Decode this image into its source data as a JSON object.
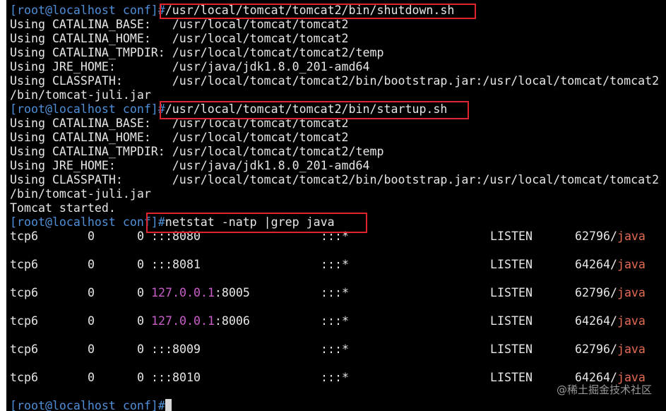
{
  "terminal": {
    "prompt": "[root@localhost conf]#",
    "blocks": [
      {
        "command": "/usr/local/tomcat/tomcat2/bin/shutdown.sh",
        "output": [
          "Using CATALINA_BASE:   /usr/local/tomcat/tomcat2",
          "Using CATALINA_HOME:   /usr/local/tomcat/tomcat2",
          "Using CATALINA_TMPDIR: /usr/local/tomcat/tomcat2/temp",
          "Using JRE_HOME:        /usr/java/jdk1.8.0_201-amd64",
          "Using CLASSPATH:       /usr/local/tomcat/tomcat2/bin/bootstrap.jar:/usr/local/tomcat/tomcat2",
          "/bin/tomcat-juli.jar"
        ]
      },
      {
        "command": "/usr/local/tomcat/tomcat2/bin/startup.sh",
        "output": [
          "Using CATALINA_BASE:   /usr/local/tomcat/tomcat2",
          "Using CATALINA_HOME:   /usr/local/tomcat/tomcat2",
          "Using CATALINA_TMPDIR: /usr/local/tomcat/tomcat2/temp",
          "Using JRE_HOME:        /usr/java/jdk1.8.0_201-amd64",
          "Using CLASSPATH:       /usr/local/tomcat/tomcat2/bin/bootstrap.jar:/usr/local/tomcat/tomcat2",
          "/bin/tomcat-juli.jar",
          "Tomcat started."
        ]
      },
      {
        "command": "netstat -natp |grep java"
      }
    ],
    "netstat_rows": [
      {
        "proto": "tcp6",
        "recv_q": "0",
        "send_q": "0",
        "local_ip": "",
        "local_port": ":::8080",
        "foreign": ":::*",
        "state": "LISTEN",
        "pid": "62796/",
        "program": "java"
      },
      {
        "proto": "tcp6",
        "recv_q": "0",
        "send_q": "0",
        "local_ip": "",
        "local_port": ":::8081",
        "foreign": ":::*",
        "state": "LISTEN",
        "pid": "64264/",
        "program": "java"
      },
      {
        "proto": "tcp6",
        "recv_q": "0",
        "send_q": "0",
        "local_ip": "127.0.0.1",
        "local_port": ":8005",
        "foreign": ":::*",
        "state": "LISTEN",
        "pid": "62796/",
        "program": "java"
      },
      {
        "proto": "tcp6",
        "recv_q": "0",
        "send_q": "0",
        "local_ip": "127.0.0.1",
        "local_port": ":8006",
        "foreign": ":::*",
        "state": "LISTEN",
        "pid": "64264/",
        "program": "java"
      },
      {
        "proto": "tcp6",
        "recv_q": "0",
        "send_q": "0",
        "local_ip": "",
        "local_port": ":::8009",
        "foreign": ":::*",
        "state": "LISTEN",
        "pid": "62796/",
        "program": "java"
      },
      {
        "proto": "tcp6",
        "recv_q": "0",
        "send_q": "0",
        "local_ip": "",
        "local_port": ":::8010",
        "foreign": ":::*",
        "state": "LISTEN",
        "pid": "64264/",
        "program": "java"
      }
    ],
    "final_prompt": "[root@localhost conf]#"
  },
  "watermark": "@稀土掘金技术社区",
  "colors": {
    "background": "#000000",
    "prompt": "#4f8fd8",
    "text": "#e6e6e6",
    "ip": "#c85ec8",
    "program": "#e86b55",
    "highlight_box": "#e0242c"
  }
}
